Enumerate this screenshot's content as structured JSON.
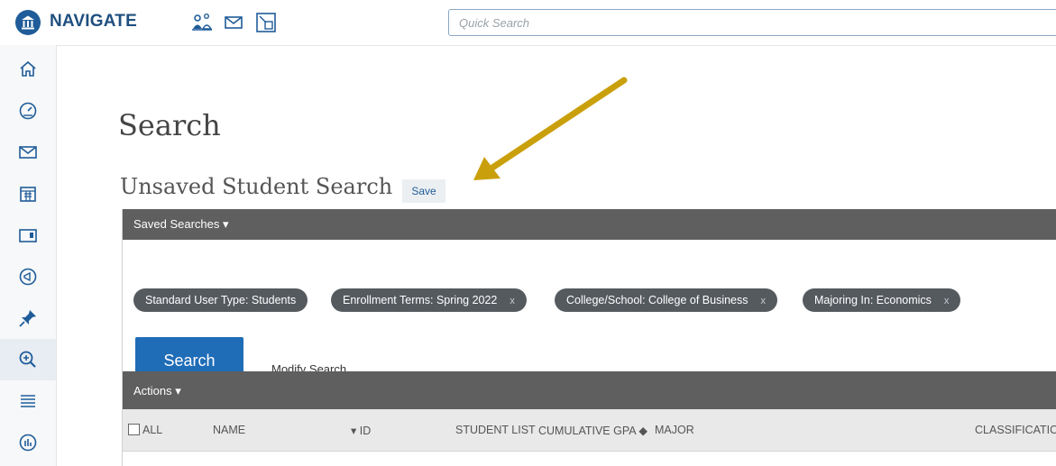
{
  "app": {
    "name": "NAVIGATE"
  },
  "topbar": {
    "icons": [
      "advising-icon",
      "mail-icon",
      "workflow-icon"
    ],
    "search": {
      "placeholder": "Quick Search",
      "value": ""
    }
  },
  "sidebar": {
    "items": [
      {
        "icon": "home-icon",
        "active": false
      },
      {
        "icon": "dashboard-icon",
        "active": false
      },
      {
        "icon": "mail-icon",
        "active": false
      },
      {
        "icon": "calendar-icon",
        "active": false
      },
      {
        "icon": "folder-icon",
        "active": false
      },
      {
        "icon": "megaphone-icon",
        "active": false
      },
      {
        "icon": "pin-icon",
        "active": false
      },
      {
        "icon": "search-plus-icon",
        "active": true
      },
      {
        "icon": "list-icon",
        "active": false
      },
      {
        "icon": "analytics-icon",
        "active": false
      }
    ]
  },
  "page": {
    "title": "Search",
    "search_name": "Unsaved Student Search",
    "save_label": "Save"
  },
  "panel": {
    "saved_searches_label": "Saved Searches ▾",
    "filters": [
      {
        "label": "Standard User Type: Students",
        "removable": false
      },
      {
        "label": "Enrollment Terms: Spring 2022",
        "removable": true
      },
      {
        "label": "College/School: College of Business",
        "removable": true
      },
      {
        "label": "Majoring In: Economics",
        "removable": true
      }
    ],
    "remove_glyph": "x",
    "search_button": "Search",
    "modify_search": "Modify Search",
    "actions_label": "Actions ▾",
    "columns": {
      "all": "ALL",
      "name": "NAME",
      "id": "▾ ID",
      "student_list": "STUDENT LIST",
      "cumulative_gpa": "CUMULATIVE GPA ◆",
      "major": "MAJOR",
      "classification": "CLASSIFICATION"
    }
  },
  "colors": {
    "brand": "#1f5c99",
    "primary_button": "#1f6cb7",
    "dark_bar": "#5f5f5f",
    "chip": "#555a5f",
    "arrow": "#c9a00c"
  }
}
